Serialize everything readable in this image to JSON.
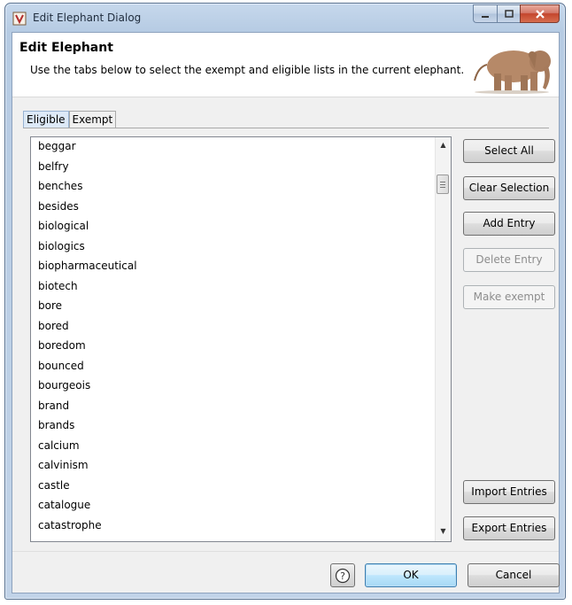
{
  "window": {
    "title": "Edit Elephant Dialog"
  },
  "header": {
    "title": "Edit Elephant",
    "description": "Use the tabs below to select the exempt and eligible lists in the current elephant."
  },
  "tabs": [
    {
      "label": "Eligible",
      "active": true
    },
    {
      "label": "Exempt",
      "active": false
    }
  ],
  "list": {
    "items": [
      "beggar",
      "belfry",
      "benches",
      "besides",
      "biological",
      "biologics",
      "biopharmaceutical",
      "biotech",
      "bore",
      "bored",
      "boredom",
      "bounced",
      "bourgeois",
      "brand",
      "brands",
      "calcium",
      "calvinism",
      "castle",
      "catalogue",
      "catastrophe"
    ]
  },
  "buttons": {
    "select_all": "Select All",
    "clear_selection": "Clear Selection",
    "add_entry": "Add Entry",
    "delete_entry": "Delete Entry",
    "make_exempt": "Make exempt",
    "import_entries": "Import Entries",
    "export_entries": "Export Entries",
    "ok": "OK",
    "cancel": "Cancel"
  },
  "icons": {
    "app": "document-icon",
    "help": "help-icon",
    "header_image": "elephant-image"
  }
}
